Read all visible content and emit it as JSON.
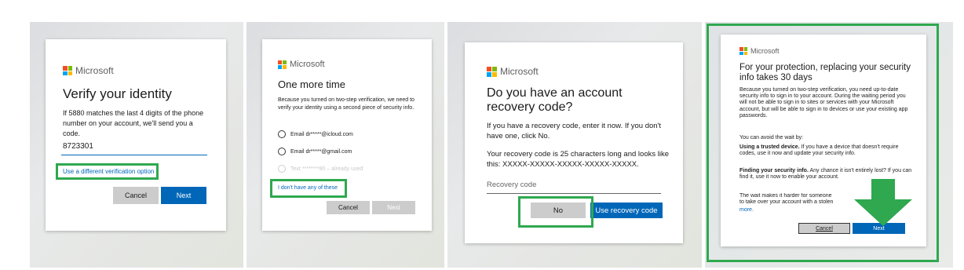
{
  "brand": "Microsoft",
  "colors": {
    "accent_blue": "#0067b8",
    "highlight_green": "#2fa84f",
    "button_gray": "#cccccc"
  },
  "panel1": {
    "title": "Verify your identity",
    "body": "If 5880 matches the last 4 digits of the phone number on your account, we'll send you a code.",
    "input_value": "8723301",
    "link": "Use a different verification option",
    "cancel": "Cancel",
    "next": "Next"
  },
  "panel2": {
    "title": "One more time",
    "body": "Because you turned on two-step verification, we need to verify your identity using a second piece of security info.",
    "options": [
      "Email dr*****@icloud.com",
      "Email dr*****@gmail.com",
      "Text ********80 – already used"
    ],
    "link": "I don't have any of these",
    "cancel": "Cancel",
    "next": "Next"
  },
  "panel3": {
    "title": "Do you have an account recovery code?",
    "body1": "If you have a recovery code, enter it now. If you don't have one, click No.",
    "body2": "Your recovery code is 25 characters long and looks like this: XXXXX-XXXXX-XXXXX-XXXXX-XXXXX.",
    "input_placeholder": "Recovery code",
    "no": "No",
    "use": "Use recovery code"
  },
  "panel4": {
    "title": "For your protection, replacing your security info takes 30 days",
    "body": "Because you turned on two-step verification, you need up-to-date security info to sign in to your account. During the waiting period you will not be able to sign in to sites or services with your Microsoft account, but will be able to sign in to devices or use your existing app passwords.",
    "avoid": "You can avoid the wait by:",
    "trusted_bold": "Using a trusted device.",
    "trusted_text": " If you have a device that doesn't require codes, use it now and update your security info.",
    "finding_bold": "Finding your security info.",
    "finding_text": " Any chance it isn't entirely lost? If you can find it, use it now to enable your account.",
    "wait_text": "The wait makes it harder for someone to take over your account with a stolen password.",
    "more": "more.",
    "cancel": "Cancel",
    "next": "Next"
  }
}
